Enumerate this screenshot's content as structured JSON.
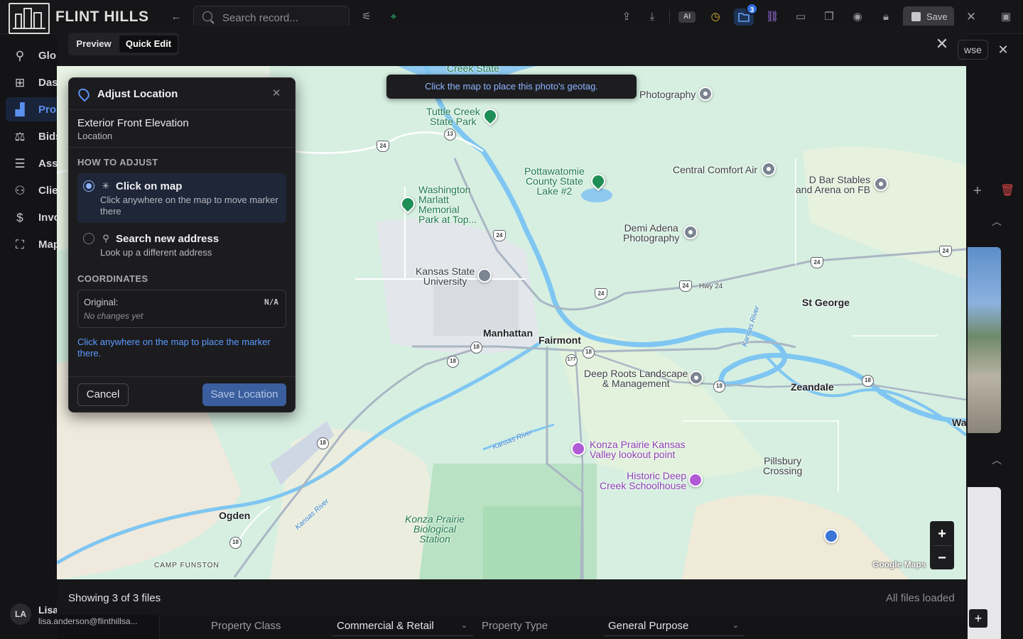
{
  "brand": {
    "name": "FLINT HILLS"
  },
  "header": {
    "search_placeholder": "Search record...",
    "ai_label": "AI",
    "notification_count": "3",
    "save_label": "Save"
  },
  "sidebar": {
    "items": [
      {
        "label": "Glob",
        "icon": "search-icon"
      },
      {
        "label": "Das",
        "icon": "dashboard-icon"
      },
      {
        "label": "Prop",
        "icon": "properties-icon",
        "active": true
      },
      {
        "label": "Bids",
        "icon": "scale-icon"
      },
      {
        "label": "Ass",
        "icon": "clipboard-icon"
      },
      {
        "label": "Clie",
        "icon": "users-icon"
      },
      {
        "label": "Invo",
        "icon": "invoice-icon"
      },
      {
        "label": "Map",
        "icon": "map-icon"
      }
    ],
    "user": {
      "initials": "LA",
      "name": "Lisa",
      "email": "lisa.anderson@flinthillsa..."
    }
  },
  "right_strip": {
    "browse_label": "wse"
  },
  "modal": {
    "tabs": [
      {
        "label": "Preview"
      },
      {
        "label": "Quick Edit",
        "active": true
      }
    ],
    "footer": {
      "left": "Showing 3 of 3 files",
      "right": "All files loaded"
    }
  },
  "map": {
    "banner": "Click the map to place this photo's geotag.",
    "zoom_in": "+",
    "zoom_out": "−",
    "attribution": "Google Maps",
    "labels": {
      "creek_state": "Creek State",
      "tuttle": "Tuttle Creek\nState Park",
      "pottawatomie": "Pottawatomie\nCounty State\nLake #2",
      "washington": "Washington\nMarlatt\nMemorial\nPark at Top...",
      "photography": "Photography",
      "central_comfort": "Central Comfort Air",
      "dbar": "D Bar Stables\nand Arena on FB",
      "demi": "Demi Adena\nPhotography",
      "ksu": "Kansas State\nUniversity",
      "manhattan": "Manhattan",
      "fairmont": "Fairmont",
      "st_george": "St George",
      "zeandale": "Zeandale",
      "deep_roots": "Deep Roots Landscape\n& Management",
      "konza_lookout": "Konza Prairie Kansas\nValley lookout point",
      "schoolhouse": "Historic Deep\nCreek Schoolhouse",
      "pillsbury": "Pillsbury\nCrossing",
      "konza_bio": "Konza Prairie\nBiological\nStation",
      "ogden": "Ogden",
      "camp_funston": "CAMP FUNSTON",
      "wa": "Wa",
      "hwy24": "Hwy 24",
      "kansas_river_1": "Kansas River",
      "kansas_river_2": "Kansas River",
      "kansas_river_3": "Kansas River"
    },
    "shields": [
      "24",
      "13",
      "24",
      "24",
      "24",
      "24",
      "24",
      "18",
      "18",
      "177",
      "18",
      "18",
      "18",
      "18",
      "18"
    ]
  },
  "panel": {
    "title": "Adjust Location",
    "photo_title": "Exterior Front Elevation",
    "photo_sub": "Location",
    "how_heading": "HOW TO ADJUST",
    "options": [
      {
        "title": "Click on map",
        "desc": "Click anywhere on the map to move marker there",
        "selected": true
      },
      {
        "title": "Search new address",
        "desc": "Look up a different address",
        "selected": false
      }
    ],
    "coords_heading": "COORDINATES",
    "original_label": "Original:",
    "original_value": "N/A",
    "original_note": "No changes yet",
    "hint": "Click anywhere on the map to place the marker there.",
    "cancel_label": "Cancel",
    "save_label": "Save Location"
  },
  "form": {
    "property_class_label": "Property Class",
    "property_class_value": "Commercial & Retail",
    "property_type_label": "Property Type",
    "property_type_value": "General Purpose"
  }
}
